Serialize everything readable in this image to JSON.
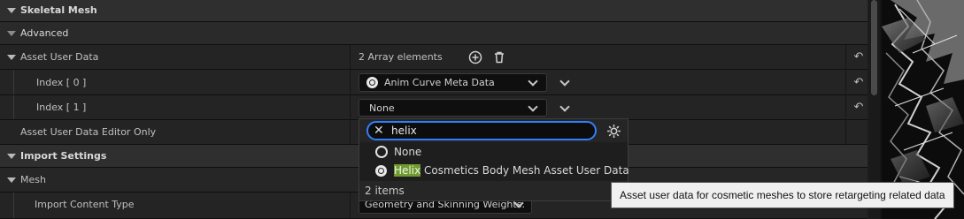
{
  "sections": {
    "skeletal_mesh": "Skeletal Mesh",
    "advanced": "Advanced",
    "import_settings": "Import Settings",
    "mesh": "Mesh"
  },
  "properties": {
    "asset_user_data": {
      "label": "Asset User Data",
      "value": "2 Array elements"
    },
    "index0": {
      "label": "Index [ 0 ]",
      "value": "Anim Curve Meta Data"
    },
    "index1": {
      "label": "Index [ 1 ]",
      "value": "None"
    },
    "editor_only": {
      "label": "Asset User Data Editor Only"
    },
    "import_content_type": {
      "label": "Import Content Type",
      "value": "Geometry and Skinning Weights."
    }
  },
  "dropdown": {
    "search_value": "helix",
    "options": [
      {
        "label": "None",
        "icon": "circle-outline-icon"
      },
      {
        "highlight": "Helix",
        "rest": " Cosmetics Body Mesh Asset User Data",
        "icon": "unreal-class-icon"
      }
    ],
    "count": "2 items"
  },
  "tooltip": {
    "text": "Asset user data for cosmetic meshes to store retargeting related data"
  },
  "colors": {
    "search_border": "#2f80ff",
    "highlight": "#6e9b2b",
    "section_bg": "#2f2f2f",
    "row_bg": "#242424"
  }
}
